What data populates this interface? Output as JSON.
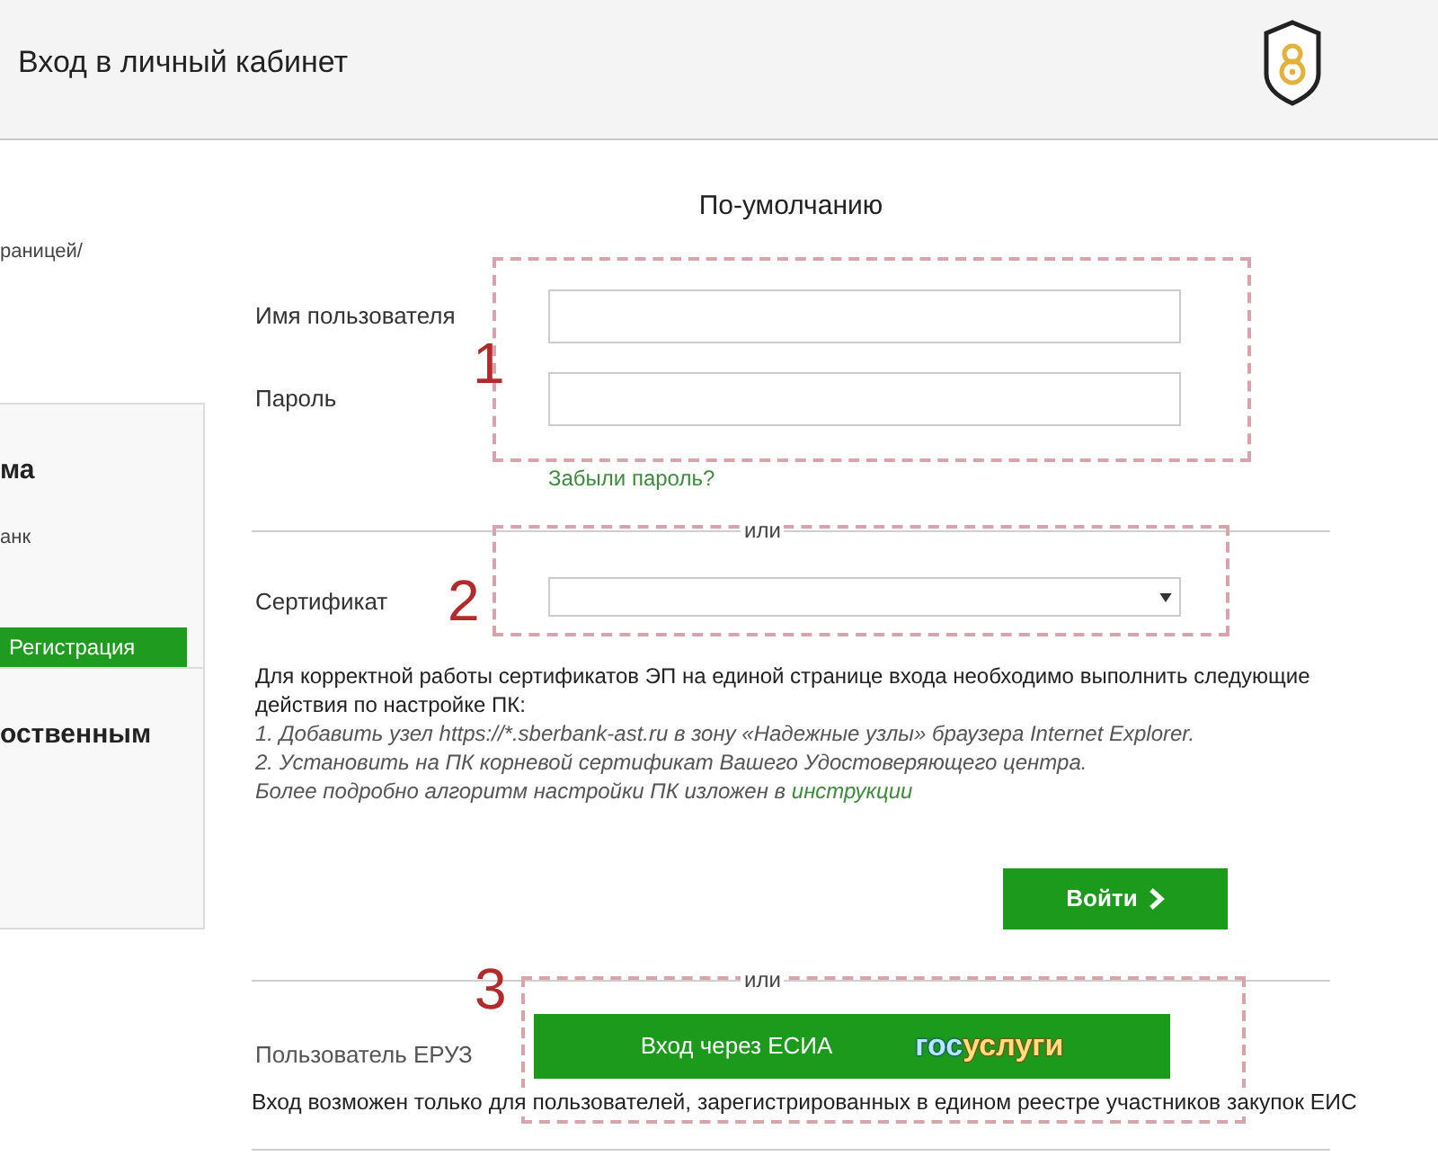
{
  "header": {
    "title": "Вход в личный кабинет"
  },
  "sidebar": {
    "breadcrumb": "раницей/",
    "card": {
      "heading": "ма",
      "text": "анк",
      "button": "Регистрация",
      "subheading": "оственным"
    }
  },
  "login": {
    "title": "По-умолчанию",
    "fields": [
      {
        "label": "Имя пользователя"
      },
      {
        "label": "Пароль"
      }
    ],
    "forgot_link": "Забыли пароль?",
    "separator": "или",
    "certificate": {
      "label": "Сертификат"
    },
    "instructions": {
      "intro": "Для корректной работы сертификатов ЭП на единой странице входа необходимо выполнить следующие действия по настройке ПК:",
      "steps": [
        "1. Добавить узел https://*.sberbank-ast.ru в зону «Надежные узлы» браузера Internet Explorer.",
        "2. Установить на ПК корневой сертификат Вашего Удостоверяющего центра."
      ],
      "more": {
        "text": "Более подробно алгоритм настройки ПК изложен в",
        "link": "инструкции"
      }
    },
    "submit": "Войти"
  },
  "esia": {
    "separator": "или",
    "label": "Пользователь ЕРУЗ",
    "button": "Вход через ЕСИА",
    "logo": [
      {
        "text": "гос",
        "color": "#b8e8ff"
      },
      {
        "text": "услуги",
        "color": "#ffe27a"
      }
    ],
    "note": "Вход возможен только для пользователей, зарегистрированных в едином реестре участников закупок ЕИС"
  },
  "annotations": [
    {
      "number": "1"
    },
    {
      "number": "2"
    },
    {
      "number": "3"
    }
  ]
}
